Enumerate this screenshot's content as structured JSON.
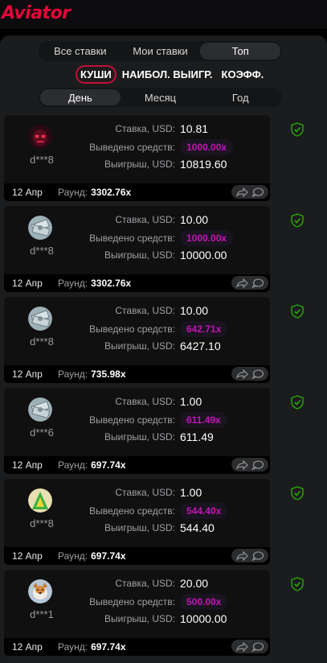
{
  "app": {
    "logo_text": "Aviator",
    "brand_color": "#e50539"
  },
  "tabs": [
    {
      "label": "Все ставки",
      "active": false
    },
    {
      "label": "Мои ставки",
      "active": false
    },
    {
      "label": "Топ",
      "active": true
    }
  ],
  "subtabs": [
    {
      "label": "КУШИ",
      "active": true
    },
    {
      "label": "НАИБОЛ. ВЫИГР.",
      "active": false
    },
    {
      "label": "КОЭФФ.",
      "active": false
    }
  ],
  "periods": [
    {
      "label": "День",
      "active": true
    },
    {
      "label": "Месяц",
      "active": false
    },
    {
      "label": "Год",
      "active": false
    }
  ],
  "labels": {
    "bet": "Ставка, USD:",
    "cashout": "Выведено средств:",
    "win": "Выигрыш, USD:",
    "round": "Раунд:"
  },
  "cards": [
    {
      "user": "d***8",
      "avatar": "red-mask-avatar",
      "bet": "10.81",
      "cashout": "1000.00x",
      "win": "10819.60",
      "date": "12 Апр",
      "round": "3302.76x"
    },
    {
      "user": "d***8",
      "avatar": "money-avatar",
      "bet": "10.00",
      "cashout": "1000.00x",
      "win": "10000.00",
      "date": "12 Апр",
      "round": "3302.76x"
    },
    {
      "user": "d***8",
      "avatar": "money-avatar",
      "bet": "10.00",
      "cashout": "642.71x",
      "win": "6427.10",
      "date": "12 Апр",
      "round": "735.98x"
    },
    {
      "user": "d***6",
      "avatar": "money-avatar",
      "bet": "1.00",
      "cashout": "611.49x",
      "win": "611.49",
      "date": "12 Апр",
      "round": "697.74x"
    },
    {
      "user": "d***8",
      "avatar": "green-a-avatar",
      "bet": "1.00",
      "cashout": "544.40x",
      "win": "544.40",
      "date": "12 Апр",
      "round": "697.74x"
    },
    {
      "user": "d***1",
      "avatar": "dog-avatar",
      "bet": "20.00",
      "cashout": "500.00x",
      "win": "10000.00",
      "date": "12 Апр",
      "round": "697.74x"
    }
  ]
}
